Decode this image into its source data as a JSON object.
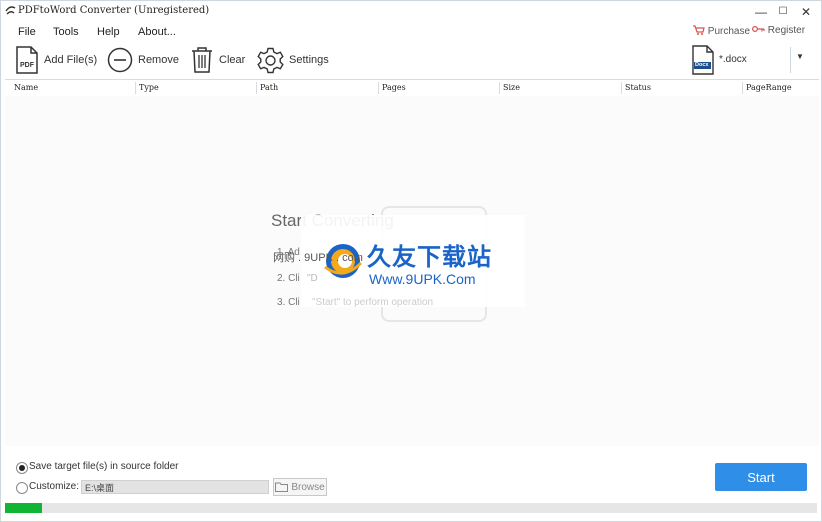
{
  "window": {
    "title": "PDFtoWord Converter (Unregistered)",
    "controls": {
      "minimize": "—",
      "maximize": "☐",
      "close": "✕"
    }
  },
  "menu": [
    "File",
    "Tools",
    "Help",
    "About..."
  ],
  "top_links": {
    "purchase": "Purchase",
    "register": "Register"
  },
  "toolbar": {
    "add_files": "Add File(s)",
    "remove": "Remove",
    "clear": "Clear",
    "settings": "Settings"
  },
  "output_format": {
    "label": "*.docx",
    "icon_text": "Docx"
  },
  "table": {
    "columns": [
      "Name",
      "Type",
      "Path",
      "Pages",
      "Size",
      "Status",
      "PageRange"
    ]
  },
  "guide": {
    "heading": "Start Converting",
    "step1": "1. Ad",
    "step2": "2. Cli",
    "step3": "3. Cli",
    "step2_fragment": "\"D",
    "step3_fragment": "\"Start\" to perform operation"
  },
  "watermark": {
    "cn": "久友下载站",
    "url": "Www.9UPK.Com",
    "side": "网购 . 9UPK . com"
  },
  "options": {
    "save_in_source": "Save target file(s) in source folder",
    "customize": "Customize:",
    "path": "E:\\桌面",
    "browse": "Browse",
    "selected": "save_in_source"
  },
  "start_button": "Start",
  "progress": 0.046,
  "colors": {
    "accent": "#2f8fe8",
    "progress": "#12b533",
    "purchase": "#d9534f"
  }
}
